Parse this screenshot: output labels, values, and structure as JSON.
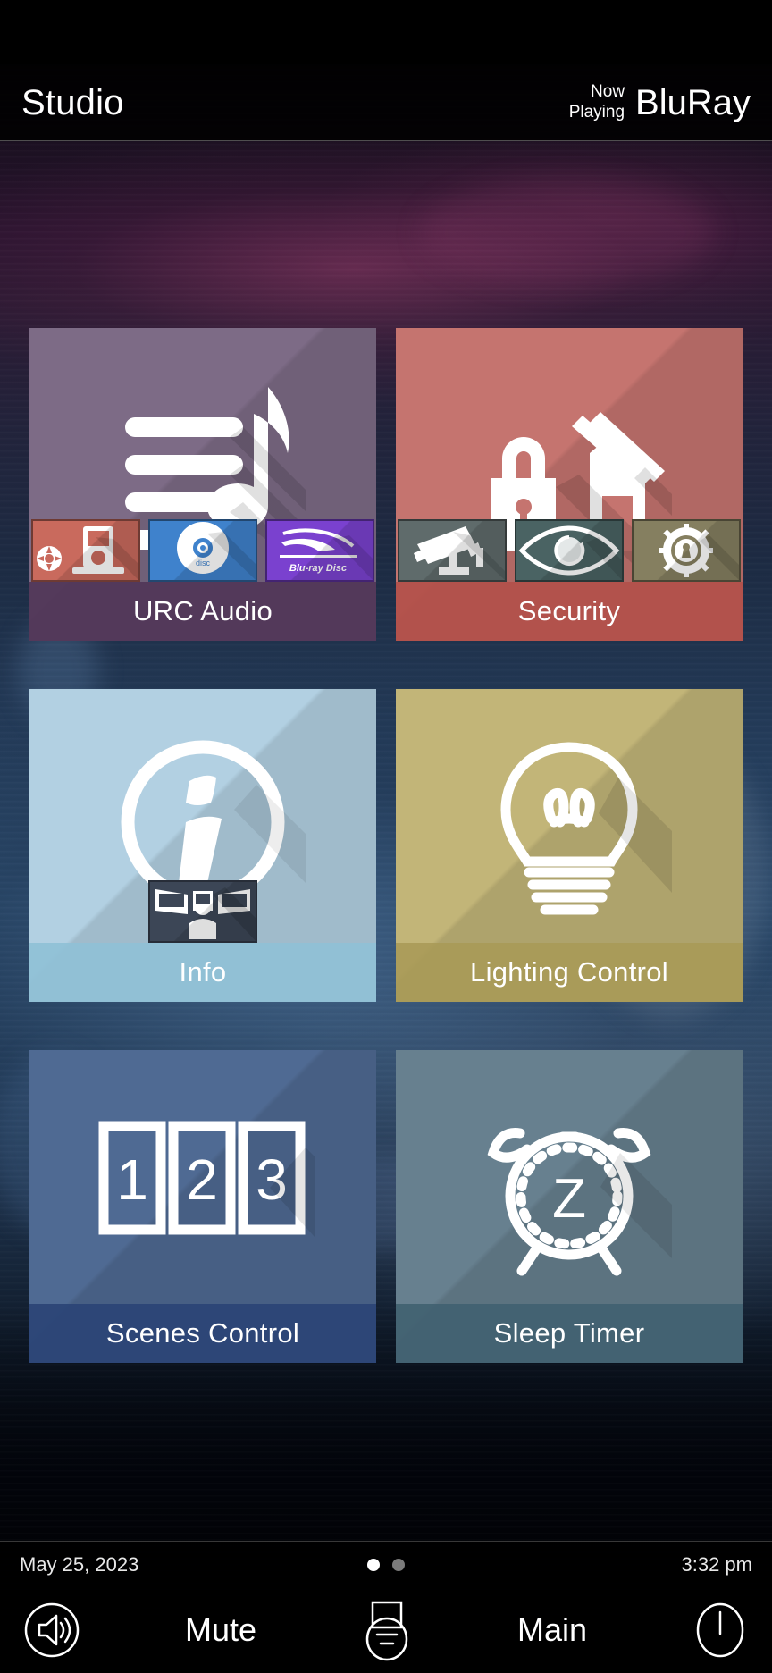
{
  "header": {
    "title": "Studio",
    "now_playing_line1": "Now",
    "now_playing_line2": "Playing",
    "now_playing_source": "BluRay"
  },
  "tiles": [
    {
      "id": "urc-audio",
      "label": "URC Audio",
      "bg_color": "#7d6b86",
      "label_bg_color": "#4e3355",
      "icon": "playlist-music-note-icon",
      "subicons": [
        {
          "id": "ipod-dock",
          "name": "ipod-dock-icon",
          "bg_color": "#c96a5d"
        },
        {
          "id": "cd-disc",
          "name": "compact-disc-icon",
          "bg_color": "#3f82cc"
        },
        {
          "id": "bluray-disc",
          "name": "bluray-disc-icon",
          "bg_color": "#7a41cf"
        }
      ]
    },
    {
      "id": "security",
      "label": "Security",
      "bg_color": "#c5746f",
      "label_bg_color": "#b2504a",
      "icon": "house-with-lock-icon",
      "subicons": [
        {
          "id": "cctv-camera",
          "name": "cctv-camera-icon",
          "bg_color": "#5f6b6b"
        },
        {
          "id": "surveillance-eye",
          "name": "eye-icon",
          "bg_color": "#4a6363"
        },
        {
          "id": "lock-settings",
          "name": "gear-lock-icon",
          "bg_color": "#857f60"
        }
      ]
    },
    {
      "id": "info",
      "label": "Info",
      "bg_color": "#b2d0e2",
      "label_bg_color": "#8fc0d6",
      "icon": "info-circle-icon",
      "subicons": [
        {
          "id": "conference-room",
          "name": "conference-presentation-icon",
          "bg_color": "#3c4656"
        }
      ]
    },
    {
      "id": "lighting-control",
      "label": "Lighting Control",
      "bg_color": "#c2b578",
      "label_bg_color": "#a89a56",
      "icon": "light-bulb-icon",
      "subicons": []
    },
    {
      "id": "scenes-control",
      "label": "Scenes Control",
      "bg_color": "#4f6a93",
      "label_bg_color": "#2a4476",
      "icon": "scenes-123-icon",
      "subicons": []
    },
    {
      "id": "sleep-timer",
      "label": "Sleep Timer",
      "bg_color": "#67808f",
      "label_bg_color": "#40606f",
      "icon": "alarm-clock-sleep-icon",
      "subicons": []
    }
  ],
  "status": {
    "date": "May 25, 2023",
    "time": "3:32 pm",
    "pages": 2,
    "active_page": 1
  },
  "controls": {
    "volume_icon": "speaker-volume-icon",
    "mute_label": "Mute",
    "device_icon": "remote-device-icon",
    "room_label": "Main",
    "power_icon": "power-icon"
  }
}
